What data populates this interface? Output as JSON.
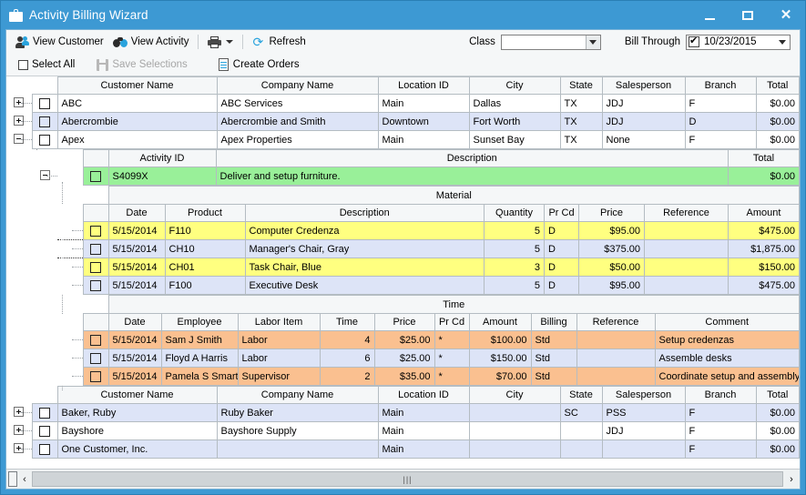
{
  "window": {
    "title": "Activity Billing Wizard",
    "icon": "briefcase-icon",
    "minimize": "–",
    "maximize": "□",
    "close": "✕"
  },
  "toolbar": {
    "view_customer": "View Customer",
    "view_activity": "View Activity",
    "print": "print-icon",
    "refresh": "Refresh",
    "class_label": "Class",
    "class_value": "",
    "bill_through_label": "Bill Through",
    "bill_through_value": "10/23/2015",
    "select_all": "Select All",
    "save_selections": "Save Selections",
    "create_orders": "Create Orders"
  },
  "customer_grid": {
    "columns": [
      "Customer Name",
      "Company Name",
      "Location ID",
      "City",
      "State",
      "Salesperson",
      "Branch",
      "Total"
    ],
    "rows_top": [
      {
        "expander": "+",
        "customer": "ABC",
        "company": "ABC Services",
        "location": "Main",
        "city": "Dallas",
        "state": "TX",
        "salesperson": "JDJ",
        "branch": "F",
        "total": "$0.00",
        "band": "A"
      },
      {
        "expander": "+",
        "customer": "Abercrombie",
        "company": "Abercrombie and Smith",
        "location": "Downtown",
        "city": "Fort Worth",
        "state": "TX",
        "salesperson": "JDJ",
        "branch": "D",
        "total": "$0.00",
        "band": "B"
      },
      {
        "expander": "–",
        "customer": "Apex",
        "company": "Apex Properties",
        "location": "Main",
        "city": "Sunset Bay",
        "state": "TX",
        "salesperson": "None",
        "branch": "F",
        "total": "$0.00",
        "band": "A"
      }
    ],
    "rows_bottom": [
      {
        "expander": "+",
        "customer": "Baker, Ruby",
        "company": "Ruby Baker",
        "location": "Main",
        "city": "",
        "state": "SC",
        "salesperson": "PSS",
        "branch": "F",
        "total": "$0.00",
        "band": "B"
      },
      {
        "expander": "+",
        "customer": "Bayshore",
        "company": "Bayshore Supply",
        "location": "Main",
        "city": "",
        "state": "",
        "salesperson": "JDJ",
        "branch": "F",
        "total": "$0.00",
        "band": "A"
      },
      {
        "expander": "+",
        "customer": "One Customer, Inc.",
        "company": "",
        "location": "Main",
        "city": "",
        "state": "",
        "salesperson": "",
        "branch": "F",
        "total": "$0.00",
        "band": "B"
      }
    ]
  },
  "activity_grid": {
    "columns": [
      "Activity ID",
      "Description",
      "Total"
    ],
    "rows": [
      {
        "expander": "–",
        "activity_id": "S4099X",
        "description": "Deliver and setup furniture.",
        "total": "$0.00",
        "highlight": "green"
      }
    ]
  },
  "material_section": {
    "title": "Material",
    "columns": [
      "Date",
      "Product",
      "Description",
      "Quantity",
      "Pr Cd",
      "Price",
      "Reference",
      "Amount"
    ],
    "rows": [
      {
        "date": "5/15/2014",
        "product": "F110",
        "description": "Computer Credenza",
        "quantity": "5",
        "prcd": "D",
        "price": "$95.00",
        "reference": "",
        "amount": "$475.00",
        "highlight": "yellow",
        "current": false
      },
      {
        "date": "5/15/2014",
        "product": "CH10",
        "description": "Manager's Chair, Gray",
        "quantity": "5",
        "prcd": "D",
        "price": "$375.00",
        "reference": "",
        "amount": "$1,875.00",
        "highlight": "blue",
        "current": true
      },
      {
        "date": "5/15/2014",
        "product": "CH01",
        "description": "Task Chair, Blue",
        "quantity": "3",
        "prcd": "D",
        "price": "$50.00",
        "reference": "",
        "amount": "$150.00",
        "highlight": "yellow",
        "current": false
      },
      {
        "date": "5/15/2014",
        "product": "F100",
        "description": "Executive Desk",
        "quantity": "5",
        "prcd": "D",
        "price": "$95.00",
        "reference": "",
        "amount": "$475.00",
        "highlight": "blue",
        "current": false
      }
    ]
  },
  "time_section": {
    "title": "Time",
    "columns": [
      "Date",
      "Employee",
      "Labor Item",
      "Time",
      "Price",
      "Pr Cd",
      "Amount",
      "Billing",
      "Reference",
      "Comment"
    ],
    "rows": [
      {
        "date": "5/15/2014",
        "employee": "Sam J Smith",
        "labor_item": "Labor",
        "time": "4",
        "price": "$25.00",
        "prcd": "*",
        "amount": "$100.00",
        "billing": "Std",
        "reference": "",
        "comment": "Setup credenzas",
        "highlight": "orange"
      },
      {
        "date": "5/15/2014",
        "employee": "Floyd A Harris",
        "labor_item": "Labor",
        "time": "6",
        "price": "$25.00",
        "prcd": "*",
        "amount": "$150.00",
        "billing": "Std",
        "reference": "",
        "comment": "Assemble desks",
        "highlight": "blue"
      },
      {
        "date": "5/15/2014",
        "employee": "Pamela S Smart",
        "labor_item": "Supervisor",
        "time": "2",
        "price": "$35.00",
        "prcd": "*",
        "amount": "$70.00",
        "billing": "Std",
        "reference": "",
        "comment": "Coordinate setup and assembly",
        "highlight": "orange"
      }
    ]
  },
  "scrollbar": {
    "left_arrow": "‹",
    "right_arrow": "›",
    "thumb_grip": "|||"
  },
  "colors": {
    "titlebar": "#3d99d3",
    "highlight_green": "#99f099",
    "highlight_yellow": "#ffff80",
    "highlight_orange": "#fac090",
    "row_alt": "#dde4f7",
    "header": "#f5f7f8",
    "accent": "#29a3dd"
  }
}
